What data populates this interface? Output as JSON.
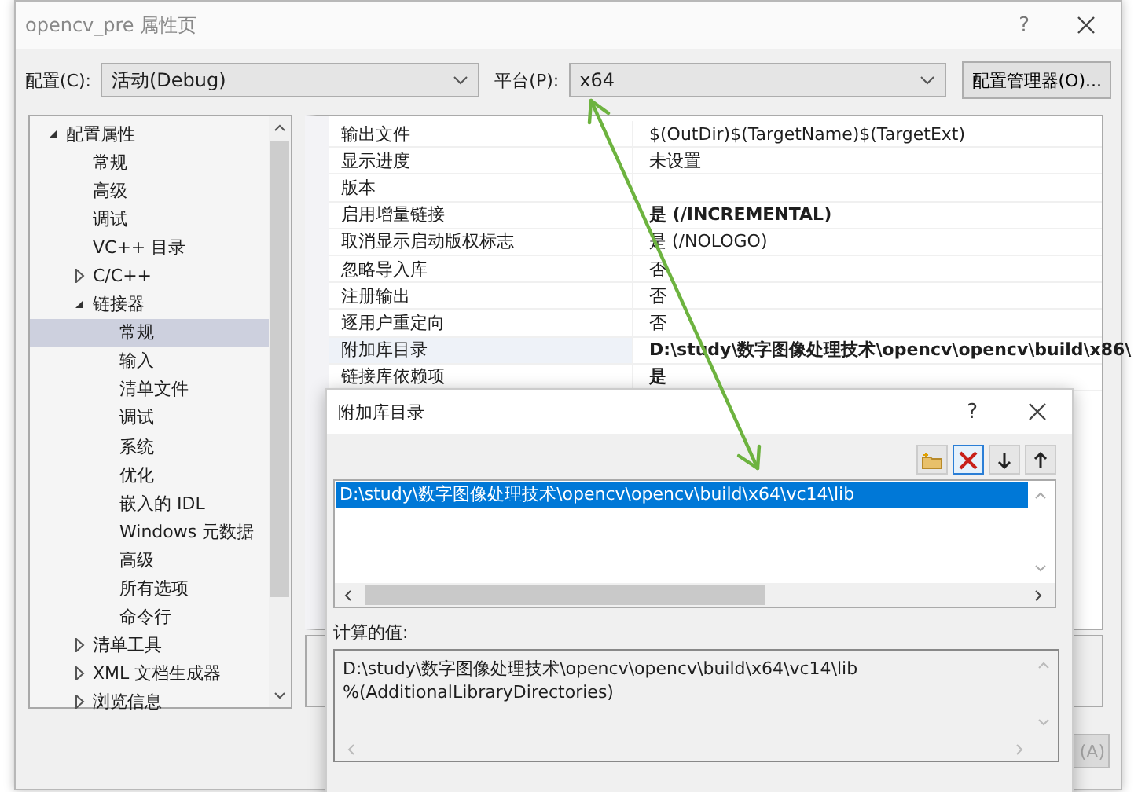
{
  "window": {
    "title": "opencv_pre 属性页",
    "help": "?"
  },
  "config": {
    "label": "配置(C):",
    "value": "活动(Debug)"
  },
  "platform": {
    "label": "平台(P):",
    "value": "x64"
  },
  "config_manager_button": "配置管理器(O)...",
  "tree": [
    {
      "label": "配置属性",
      "expanded": true,
      "selected": false,
      "children": [
        {
          "label": "常规",
          "selected": false
        },
        {
          "label": "高级",
          "selected": false
        },
        {
          "label": "调试",
          "selected": false
        },
        {
          "label": "VC++ 目录",
          "selected": false
        },
        {
          "label": "C/C++",
          "expanded": false,
          "selected": false
        },
        {
          "label": "链接器",
          "expanded": true,
          "selected": false,
          "children": [
            {
              "label": "常规",
              "selected": true
            },
            {
              "label": "输入",
              "selected": false
            },
            {
              "label": "清单文件",
              "selected": false
            },
            {
              "label": "调试",
              "selected": false
            },
            {
              "label": "系统",
              "selected": false
            },
            {
              "label": "优化",
              "selected": false
            },
            {
              "label": "嵌入的 IDL",
              "selected": false
            },
            {
              "label": "Windows 元数据",
              "selected": false
            },
            {
              "label": "高级",
              "selected": false
            },
            {
              "label": "所有选项",
              "selected": false
            },
            {
              "label": "命令行",
              "selected": false
            }
          ]
        },
        {
          "label": "清单工具",
          "expanded": false,
          "selected": false
        },
        {
          "label": "XML 文档生成器",
          "expanded": false,
          "selected": false
        },
        {
          "label": "浏览信息",
          "expanded": false,
          "selected": false
        }
      ]
    }
  ],
  "properties": [
    {
      "name": "输出文件",
      "value": "$(OutDir)$(TargetName)$(TargetExt)",
      "bold": false,
      "selected": false
    },
    {
      "name": "显示进度",
      "value": "未设置",
      "bold": false,
      "selected": false
    },
    {
      "name": "版本",
      "selected": false
    },
    {
      "name": "启用增量链接",
      "value": "是 (/INCREMENTAL)",
      "bold": true,
      "selected": false
    },
    {
      "name": "取消显示启动版权标志",
      "value": "是 (/NOLOGO)",
      "bold": false,
      "selected": false
    },
    {
      "name": "忽略导入库",
      "value": "否",
      "bold": false,
      "selected": false
    },
    {
      "name": "注册输出",
      "value": "否",
      "bold": false,
      "selected": false
    },
    {
      "name": "逐用户重定向",
      "value": "否",
      "bold": false,
      "selected": false
    },
    {
      "name": "附加库目录",
      "value": "D:\\study\\数字图像处理技术\\opencv\\opencv\\build\\x86\\",
      "bold": true,
      "selected": true
    },
    {
      "name": "链接库依赖项",
      "value": "是",
      "bold": true,
      "selected": false
    }
  ],
  "apply_button": {
    "label": "(A)",
    "disabled": true
  },
  "dialog": {
    "title": "附加库目录",
    "help": "?",
    "toolbar": [
      {
        "kind": "new-folder",
        "pressed": false
      },
      {
        "kind": "delete",
        "pressed": true
      },
      {
        "kind": "move-down",
        "pressed": false
      },
      {
        "kind": "move-up",
        "pressed": false
      }
    ],
    "entries": [
      {
        "text": "D:\\study\\数字图像处理技术\\opencv\\opencv\\build\\x64\\vc14\\lib",
        "selected": true
      }
    ],
    "computed_label": "计算的值:",
    "computed_lines": [
      "D:\\study\\数字图像处理技术\\opencv\\opencv\\build\\x64\\vc14\\lib",
      "%(AdditionalLibraryDirectories)"
    ]
  }
}
